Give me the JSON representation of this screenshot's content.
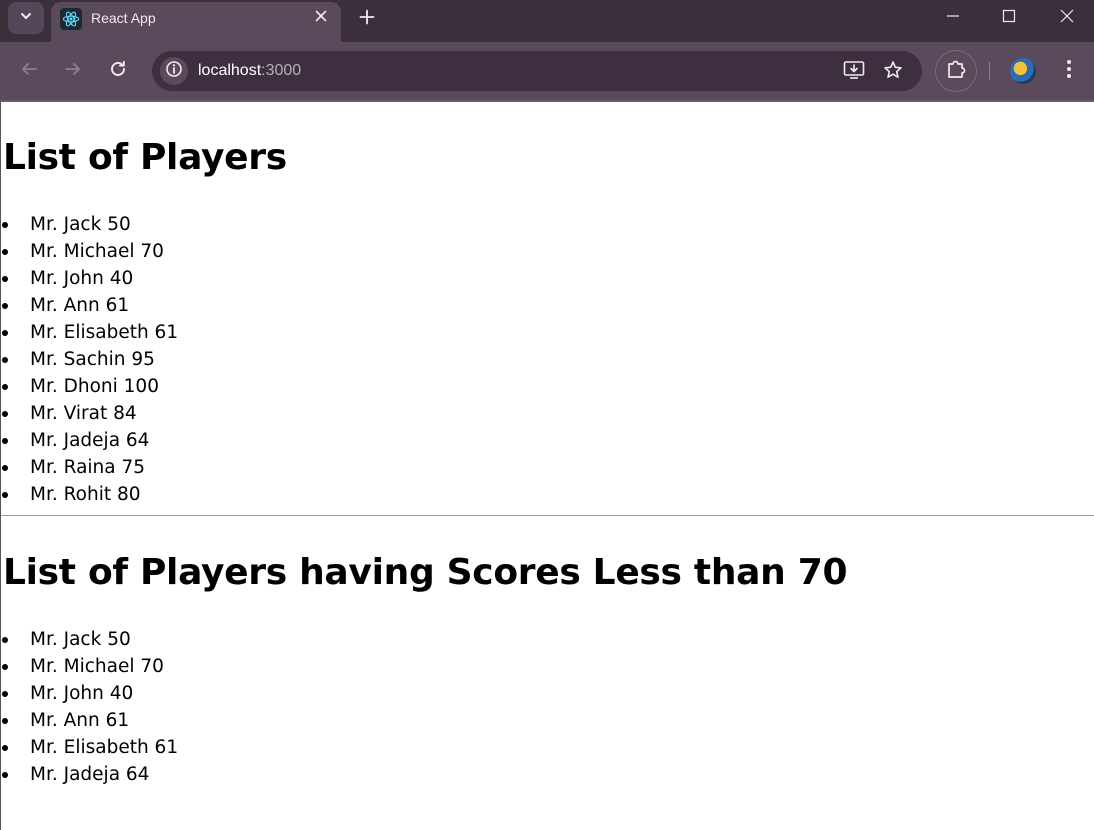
{
  "browser": {
    "tab_title": "React App",
    "url_host": "localhost",
    "url_port": ":3000",
    "accent": "#5a4a5c",
    "tabbar_bg": "#3c2f3c"
  },
  "page": {
    "heading_all": "List of Players",
    "players_all": [
      "Mr. Jack 50",
      "Mr. Michael 70",
      "Mr. John 40",
      "Mr. Ann 61",
      "Mr. Elisabeth 61",
      "Mr. Sachin 95",
      "Mr. Dhoni 100",
      "Mr. Virat 84",
      "Mr. Jadeja 64",
      "Mr. Raina 75",
      "Mr. Rohit 80"
    ],
    "heading_filtered": "List of Players having Scores Less than 70",
    "players_filtered": [
      "Mr. Jack 50",
      "Mr. Michael 70",
      "Mr. John 40",
      "Mr. Ann 61",
      "Mr. Elisabeth 61",
      "Mr. Jadeja 64"
    ]
  }
}
